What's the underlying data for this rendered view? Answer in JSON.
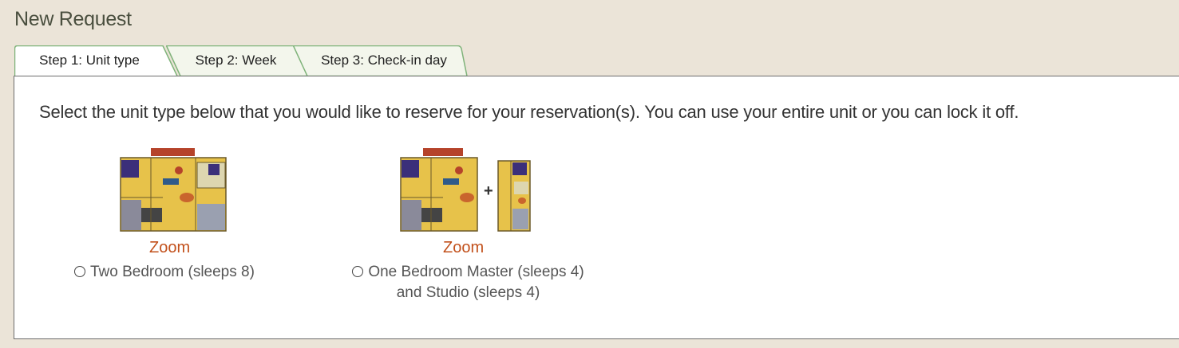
{
  "page": {
    "title": "New Request"
  },
  "tabs": [
    {
      "label": "Step 1: Unit type",
      "active": true
    },
    {
      "label": "Step 2: Week",
      "active": false
    },
    {
      "label": "Step 3: Check-in day",
      "active": false
    }
  ],
  "main": {
    "instructions": "Select the unit type below that you would like to reserve for your reservation(s). You can use your entire unit or you can lock it off.",
    "options": [
      {
        "zoom": "Zoom",
        "label_line1": "Two Bedroom (sleeps 8)",
        "label_line2": ""
      },
      {
        "zoom": "Zoom",
        "plus": "+",
        "label_line1": "One Bedroom Master (sleeps 4)",
        "label_line2": "and Studio (sleeps 4)"
      }
    ]
  },
  "colors": {
    "background": "#ebe4d8",
    "tab_border": "#7fb37a",
    "zoom_link": "#c2501b",
    "floorplan_yellow": "#e7c24a",
    "floorplan_purple": "#3b2f7a"
  }
}
